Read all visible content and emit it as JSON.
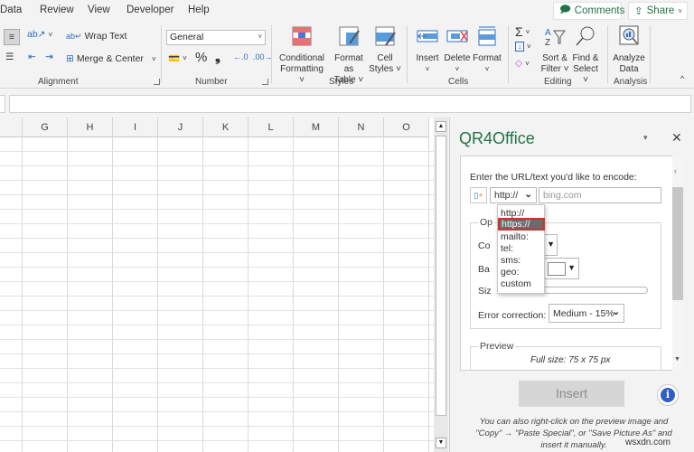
{
  "menu": {
    "items": [
      "Data",
      "Review",
      "View",
      "Developer",
      "Help"
    ],
    "comments_label": "Comments",
    "share_label": "Share"
  },
  "ribbon": {
    "alignment": {
      "wrap_text": "Wrap Text",
      "merge_center": "Merge & Center",
      "group_label": "Alignment"
    },
    "number": {
      "format_value": "General",
      "percent": "%",
      "comma": "❟",
      "group_label": "Number"
    },
    "styles": {
      "conditional_formatting": [
        "Conditional",
        "Formatting ˅"
      ],
      "format_as_table": [
        "Format as",
        "Table ˅"
      ],
      "cell_styles": [
        "Cell",
        "Styles ˅"
      ],
      "group_label": "Styles"
    },
    "cells": {
      "insert": "Insert",
      "delete": "Delete",
      "format": "Format",
      "group_label": "Cells"
    },
    "editing": {
      "sort_filter": [
        "Sort &",
        "Filter ˅"
      ],
      "find_select": [
        "Find &",
        "Select ˅"
      ],
      "group_label": "Editing"
    },
    "analysis": {
      "analyze_data": [
        "Analyze",
        "Data"
      ],
      "group_label": "Analysis"
    }
  },
  "sheet": {
    "columns": [
      "G",
      "H",
      "I",
      "J",
      "K",
      "L",
      "M",
      "N",
      "O"
    ]
  },
  "task_pane": {
    "title": "QR4Office",
    "prompt": "Enter the URL/text you'd like to encode:",
    "protocol_value": "http://",
    "url_placeholder": "bing.com",
    "protocol_options": [
      "http://",
      "https://",
      "mailto:",
      "tel:",
      "sms:",
      "geo:",
      "custom"
    ],
    "highlighted_option": "https://",
    "options_legend": "Op",
    "color_label": "Co",
    "background_label": "Ba",
    "size_label": "Siz",
    "error_correction_label": "Error correction:",
    "error_correction_value": "Medium - 15%",
    "preview_legend": "Preview",
    "full_size": "Full size: 75 x 75 px",
    "insert_label": "Insert",
    "info_glyph": "i",
    "help_text": "You can also right-click on the preview image and \"Copy\" → \"Paste Special\", or \"Save Picture As\" and insert it manually."
  },
  "watermark": "wsxdn.com"
}
